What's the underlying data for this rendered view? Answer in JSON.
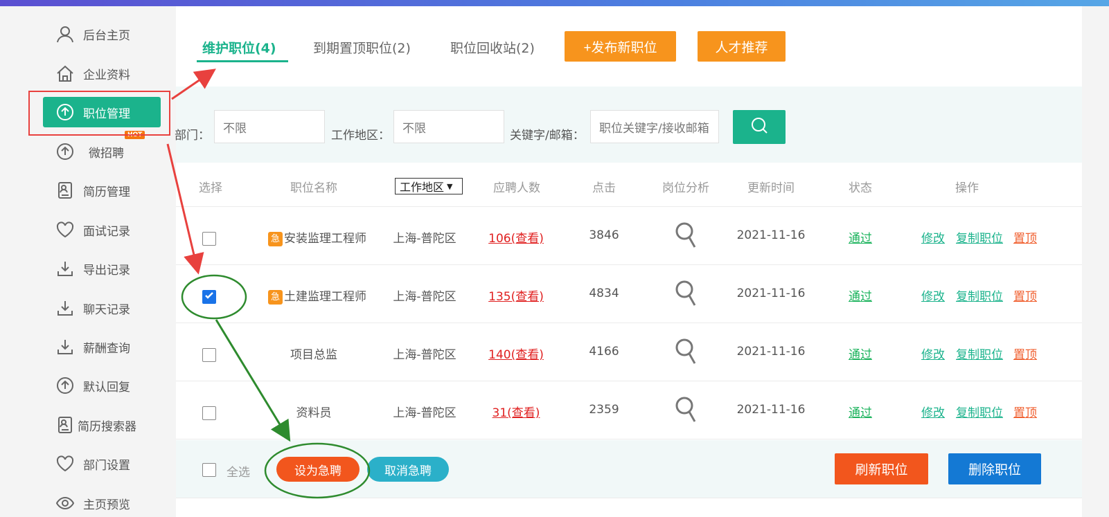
{
  "sidebar": {
    "items": [
      {
        "label": "后台主页",
        "icon": "user-icon"
      },
      {
        "label": "企业资料",
        "icon": "home-icon"
      },
      {
        "label": "职位管理",
        "icon": "upload-icon",
        "active": true
      },
      {
        "label": "微招聘",
        "icon": "upload-icon",
        "badge": "HOT"
      },
      {
        "label": "简历管理",
        "icon": "resume-icon"
      },
      {
        "label": "面试记录",
        "icon": "heart-icon"
      },
      {
        "label": "导出记录",
        "icon": "download-icon"
      },
      {
        "label": "聊天记录",
        "icon": "download-icon"
      },
      {
        "label": "薪酬查询",
        "icon": "download-icon"
      },
      {
        "label": "默认回复",
        "icon": "upload-icon"
      },
      {
        "label": "简历搜索器",
        "icon": "resume-icon"
      },
      {
        "label": "部门设置",
        "icon": "heart-icon"
      },
      {
        "label": "主页预览",
        "icon": "eye-icon"
      }
    ]
  },
  "tabs": [
    {
      "label": "维护职位(4)",
      "active": true
    },
    {
      "label": "到期置顶职位(2)"
    },
    {
      "label": "职位回收站(2)"
    }
  ],
  "actions": {
    "publish": "+发布新职位",
    "talent": "人才推荐"
  },
  "filter": {
    "dept_label": "部门：",
    "dept_value": "不限",
    "area_label": "工作地区：",
    "area_value": "不限",
    "keyword_label": "关键字/邮箱：",
    "keyword_placeholder": "职位关键字/接收邮箱"
  },
  "table": {
    "headers": {
      "select": "选择",
      "name": "职位名称",
      "area": "工作地区",
      "applicants": "应聘人数",
      "clicks": "点击",
      "analysis": "岗位分析",
      "updated": "更新时间",
      "status": "状态",
      "ops": "操作"
    },
    "rows": [
      {
        "checked": false,
        "urgent": true,
        "urgent_tag": "急",
        "name": "安装监理工程师",
        "area": "上海-普陀区",
        "applicants": "106(查看)",
        "clicks": "3846",
        "updated": "2021-11-16",
        "status": "通过",
        "edit": "修改",
        "copy": "复制职位",
        "top": "置顶"
      },
      {
        "checked": true,
        "urgent": true,
        "urgent_tag": "急",
        "name": "土建监理工程师",
        "area": "上海-普陀区",
        "applicants": "135(查看)",
        "clicks": "4834",
        "updated": "2021-11-16",
        "status": "通过",
        "edit": "修改",
        "copy": "复制职位",
        "top": "置顶"
      },
      {
        "checked": false,
        "urgent": false,
        "name": "项目总监",
        "area": "上海-普陀区",
        "applicants": "140(查看)",
        "clicks": "4166",
        "updated": "2021-11-16",
        "status": "通过",
        "edit": "修改",
        "copy": "复制职位",
        "top": "置顶"
      },
      {
        "checked": false,
        "urgent": false,
        "name": "资料员",
        "area": "上海-普陀区",
        "applicants": "31(查看)",
        "clicks": "2359",
        "updated": "2021-11-16",
        "status": "通过",
        "edit": "修改",
        "copy": "复制职位",
        "top": "置顶"
      }
    ]
  },
  "footer": {
    "select_all": "全选",
    "set_urgent": "设为急聘",
    "cancel_urgent": "取消急聘",
    "refresh": "刷新职位",
    "delete": "删除职位"
  },
  "colors": {
    "accent": "#1bb38c",
    "orange": "#f7941d",
    "annotation_red": "#e8413e",
    "annotation_green": "#2e8b2e"
  }
}
